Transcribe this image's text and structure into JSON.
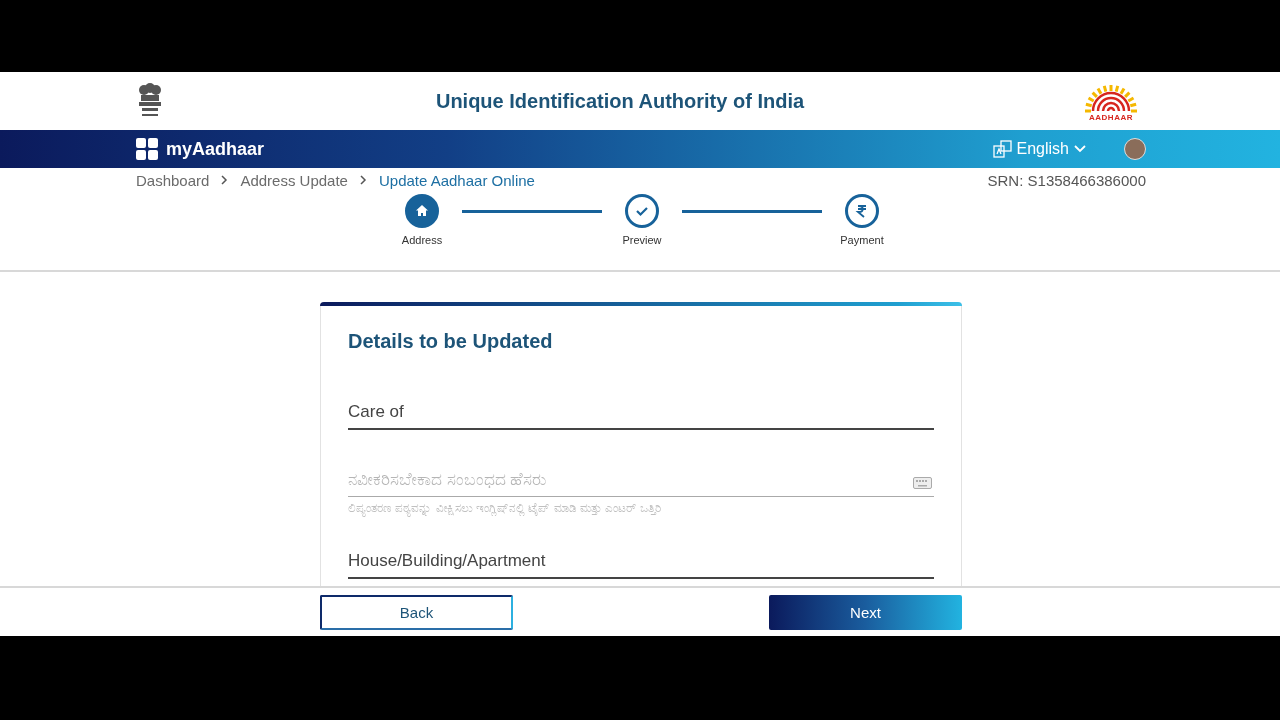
{
  "header": {
    "title": "Unique Identification Authority of India",
    "logo_text": "AADHAAR"
  },
  "nav": {
    "brand": "myAadhaar",
    "language": "English"
  },
  "breadcrumbs": [
    {
      "label": "Dashboard",
      "selected": false
    },
    {
      "label": "Address Update",
      "selected": false
    },
    {
      "label": "Update Aadhaar Online",
      "selected": true
    }
  ],
  "srn": "SRN: S1358466386000",
  "steps": [
    {
      "label": "Address",
      "selected": true
    },
    {
      "label": "Preview",
      "selected": false
    },
    {
      "label": "Payment",
      "selected": false
    }
  ],
  "card": {
    "title": "Details to be Updated",
    "fields": [
      {
        "kind": "text",
        "placeholder": "Care of"
      },
      {
        "kind": "transliteration",
        "placeholder": "ನವೀಕರಿಸಬೇಕಾದ ಸಂಬಂಧದ ಹೆಸರು",
        "hint": "ಲಿಪ್ಯಂತರಣ ಪಠ್ಯವನ್ನು ವೀಕ್ಷಿಸಲು ಇಂಗ್ಲಿಷ್‌ನಲ್ಲಿ ಟೈಪ್ ಮಾಡಿ ಮತ್ತು ಎಂಟರ್ ಒತ್ತಿರಿ"
      },
      {
        "kind": "text",
        "placeholder": "House/Building/Apartment"
      }
    ]
  },
  "buttons": [
    {
      "kind": "outline",
      "label": "Back"
    },
    {
      "kind": "primary",
      "label": "Next"
    }
  ]
}
